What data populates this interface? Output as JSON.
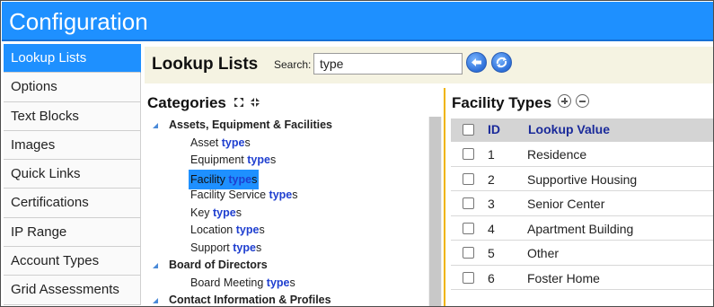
{
  "app": {
    "title": "Configuration"
  },
  "sidebar": {
    "items": [
      {
        "label": "Lookup Lists",
        "active": true
      },
      {
        "label": "Options"
      },
      {
        "label": "Text Blocks"
      },
      {
        "label": "Images"
      },
      {
        "label": "Quick Links"
      },
      {
        "label": "Certifications"
      },
      {
        "label": "IP Range"
      },
      {
        "label": "Account Types"
      },
      {
        "label": "Grid Assessments"
      }
    ]
  },
  "toolbar": {
    "heading": "Lookup Lists",
    "search_label": "Search:",
    "search_value": "type",
    "back_icon": "back-arrow-icon",
    "refresh_icon": "refresh-icon"
  },
  "categories": {
    "heading": "Categories",
    "groups": [
      {
        "label": "Assets, Equipment & Facilities",
        "items": [
          {
            "pre": "Asset ",
            "match": "type",
            "post": "s"
          },
          {
            "pre": "Equipment ",
            "match": "type",
            "post": "s"
          },
          {
            "pre": "Facility ",
            "match": "type",
            "post": "s",
            "selected": true
          },
          {
            "pre": "Facility Service ",
            "match": "type",
            "post": "s"
          },
          {
            "pre": "Key ",
            "match": "type",
            "post": "s"
          },
          {
            "pre": "Location ",
            "match": "type",
            "post": "s"
          },
          {
            "pre": "Support ",
            "match": "type",
            "post": "s"
          }
        ]
      },
      {
        "label": "Board of Directors",
        "items": [
          {
            "pre": "Board Meeting ",
            "match": "type",
            "post": "s"
          }
        ]
      },
      {
        "label": "Contact Information & Profiles",
        "items": []
      }
    ]
  },
  "facility": {
    "heading": "Facility Types",
    "columns": {
      "id": "ID",
      "value": "Lookup Value"
    },
    "rows": [
      {
        "id": "1",
        "value": "Residence"
      },
      {
        "id": "2",
        "value": "Supportive Housing"
      },
      {
        "id": "3",
        "value": "Senior Center"
      },
      {
        "id": "4",
        "value": "Apartment Building"
      },
      {
        "id": "5",
        "value": "Other"
      },
      {
        "id": "6",
        "value": "Foster Home"
      }
    ]
  },
  "colors": {
    "accent": "#1e90ff",
    "toolbar_bg": "#f5f3e2",
    "divider": "#f0b400",
    "match_text": "#1f3fd0"
  }
}
